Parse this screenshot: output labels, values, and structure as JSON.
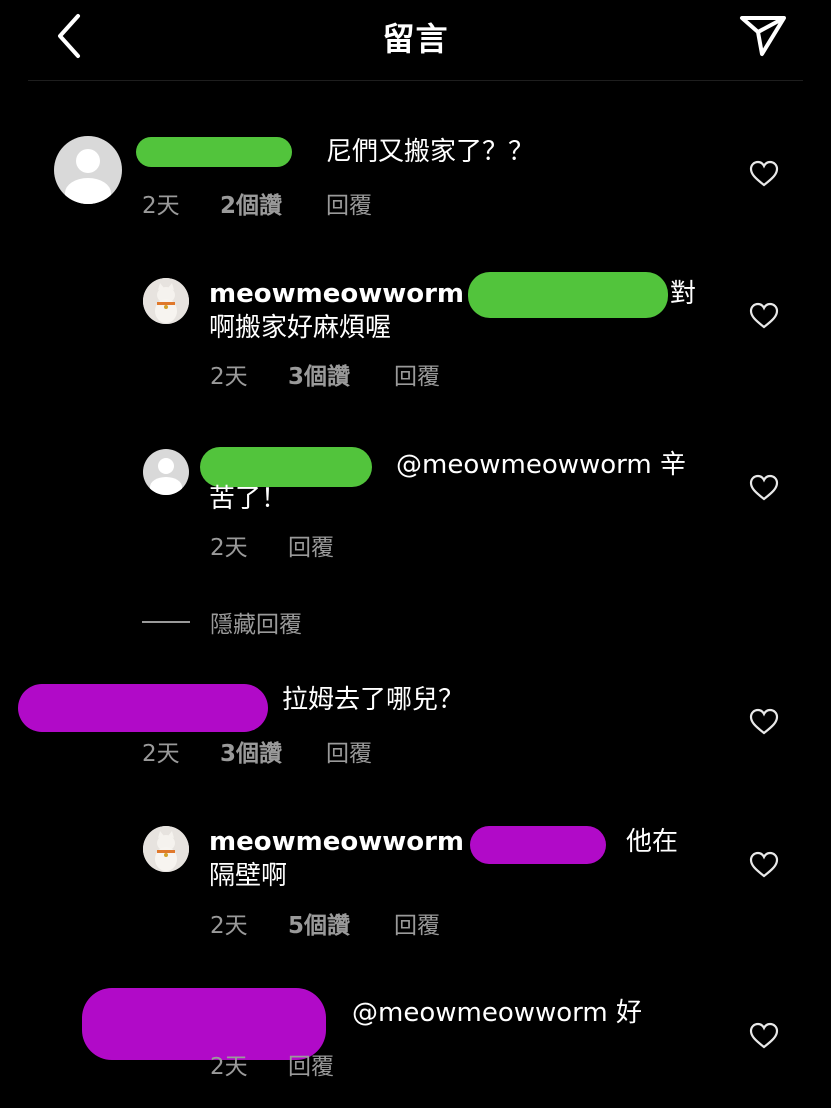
{
  "header": {
    "title": "留言"
  },
  "comments": [
    {
      "text": "尼們又搬家了？？",
      "time": "2天",
      "likes": "2個讚",
      "reply": "回覆"
    },
    {
      "user": "meowmeowworm",
      "text_end": "對",
      "text_line2": "啊搬家好麻煩喔",
      "time": "2天",
      "likes": "3個讚",
      "reply": "回覆"
    },
    {
      "text": "@meowmeowworm 辛",
      "text_line2": "苦了！",
      "time": "2天",
      "reply": "回覆"
    },
    {
      "text": "拉姆去了哪兒？",
      "time": "2天",
      "likes": "3個讚",
      "reply": "回覆"
    },
    {
      "user": "meowmeowworm",
      "text_end": "他在",
      "text_line2": "隔壁啊",
      "time": "2天",
      "likes": "5個讚",
      "reply": "回覆"
    },
    {
      "text": "@meowmeowworm 好",
      "time": "2天",
      "reply": "回覆"
    }
  ],
  "hide_replies": "隱藏回覆",
  "icons": {
    "back": "chevron-left-icon",
    "send": "paper-plane-icon",
    "like": "heart-icon"
  },
  "colors": {
    "redaction_green": "#52c43c",
    "redaction_purple": "#b10ac8"
  }
}
